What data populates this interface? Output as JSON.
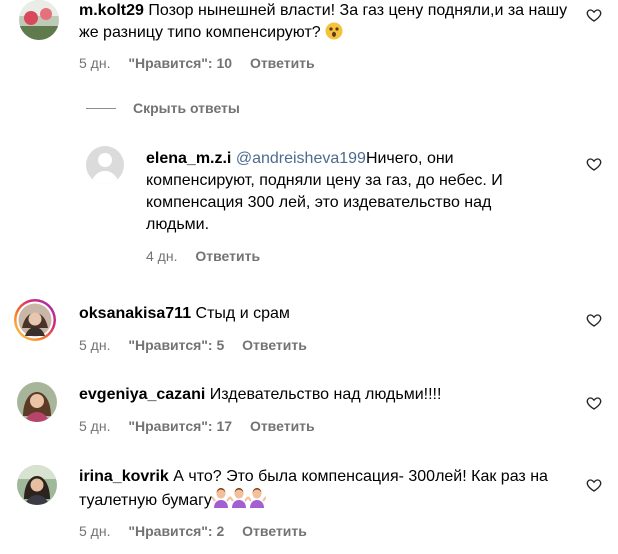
{
  "comments": [
    {
      "username": "m.kolt29",
      "text": "Позор нынешней власти! За газ цену подняли,и за нашу же разницу типо компенсируют?",
      "emoji": "astonished-face",
      "time": "5 дн.",
      "likes": "\"Нравится\": 10",
      "reply": "Ответить"
    },
    {
      "username": "oksanakisa711",
      "text": "Стыд и срам",
      "time": "5 дн.",
      "likes": "\"Нравится\": 5",
      "reply": "Ответить"
    },
    {
      "username": "evgeniya_cazani",
      "text": "Издевательство над людьми!!!!",
      "time": "5 дн.",
      "likes": "\"Нравится\": 17",
      "reply": "Ответить"
    },
    {
      "username": "irina_kovrik",
      "text": "А что? Это была компенсация- 300лей! Как раз на туалетную бумагу",
      "emoji": "person-shrugging-x3",
      "time": "5 дн.",
      "likes": "\"Нравится\": 2",
      "reply": "Ответить"
    }
  ],
  "hide_replies": "Скрыть ответы",
  "reply_comment": {
    "username": "elena_m.z.i",
    "mention": "@andreisheva199",
    "text": "Ничего, они компенсируют, подняли цену за газ, до небес. И компенсация 300 лей, это издевательство над людьми.",
    "time": "4 дн.",
    "reply": "Ответить"
  },
  "colors": {
    "meta_gray": "#737373",
    "mention_blue": "#4b6b8f",
    "story_ring": "#d62976"
  }
}
